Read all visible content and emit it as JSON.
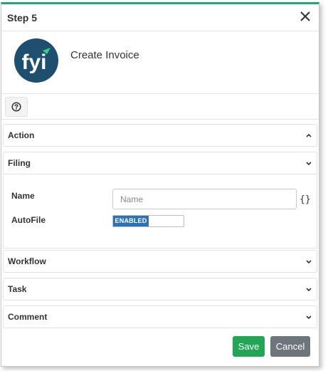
{
  "dialog": {
    "title": "Step 5",
    "close_icon": "close-icon",
    "accent_color": "#22a876"
  },
  "hero": {
    "logo_text": "fyi",
    "logo_color": "#1e4f6e",
    "title": "Create Invoice"
  },
  "help": {
    "icon": "question-circle-icon"
  },
  "sections": {
    "action": {
      "label": "Action",
      "expanded": false
    },
    "filing": {
      "label": "Filing",
      "expanded": true
    },
    "workflow": {
      "label": "Workflow",
      "expanded": false
    },
    "task": {
      "label": "Task",
      "expanded": false
    },
    "comment": {
      "label": "Comment",
      "expanded": false
    }
  },
  "filing": {
    "name_label": "Name",
    "name_value": "",
    "name_placeholder": "Name",
    "braces_icon": "{}",
    "autofile_label": "AutoFile",
    "autofile_state": "ENABLED",
    "toggle_color": "#2a73b8"
  },
  "footer": {
    "save_label": "Save",
    "cancel_label": "Cancel",
    "save_color": "#22a655",
    "cancel_color": "#6d757d"
  }
}
